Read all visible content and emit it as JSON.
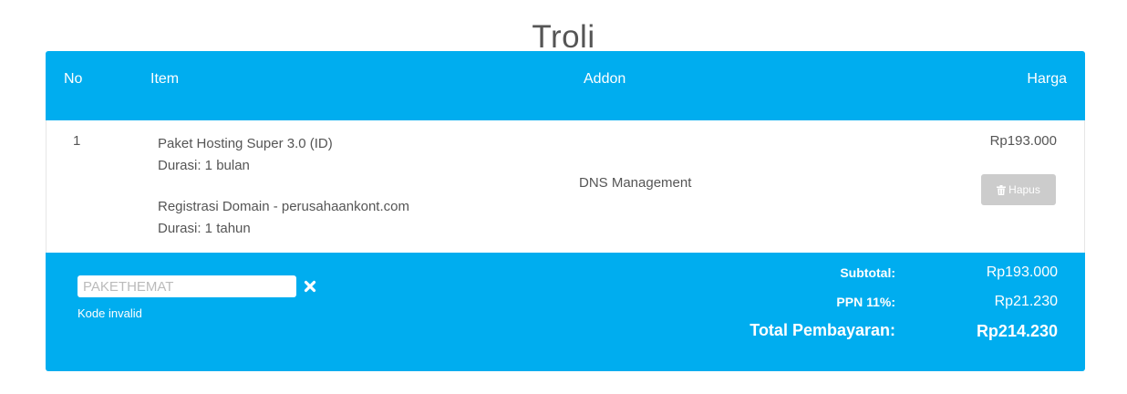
{
  "page": {
    "title": "Troli"
  },
  "table": {
    "headers": {
      "no": "No",
      "item": "Item",
      "addon": "Addon",
      "price": "Harga"
    },
    "rows": [
      {
        "no": "1",
        "item_1_name": "Paket Hosting Super 3.0 (ID)",
        "item_1_duration": "Durasi: 1 bulan",
        "item_2_name": "Registrasi Domain - perusahaankont.com",
        "item_2_duration": "Durasi: 1 tahun",
        "addon": "DNS Management",
        "price": "Rp193.000",
        "delete_label": "Hapus",
        "delete_icon": "trash-icon"
      }
    ]
  },
  "promo": {
    "value": "PAKETHEMAT",
    "message": "Kode invalid",
    "clear_icon": "close-icon"
  },
  "totals": {
    "subtotal_label": "Subtotal:",
    "subtotal_value": "Rp193.000",
    "tax_label": "PPN 11%:",
    "tax_value": "Rp21.230",
    "total_label": "Total Pembayaran:",
    "total_value": "Rp214.230"
  },
  "colors": {
    "accent": "#00adef",
    "button_disabled": "#cccccc"
  }
}
